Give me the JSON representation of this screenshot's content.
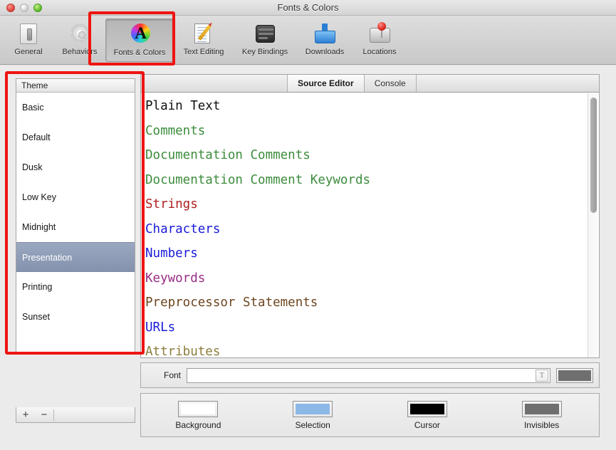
{
  "window": {
    "title": "Fonts & Colors",
    "traffic_lights": [
      "close-button",
      "minimize-button",
      "zoom-button"
    ]
  },
  "toolbar": {
    "items": [
      {
        "label": "General",
        "icon": "switch-plate-icon",
        "selected": false
      },
      {
        "label": "Behaviors",
        "icon": "gear-icon",
        "selected": false
      },
      {
        "label": "Fonts & Colors",
        "icon": "color-wheel-a-icon",
        "selected": true
      },
      {
        "label": "Text Editing",
        "icon": "paper-pencil-icon",
        "selected": false
      },
      {
        "label": "Key Bindings",
        "icon": "keyboard-icon",
        "selected": false
      },
      {
        "label": "Downloads",
        "icon": "download-tray-icon",
        "selected": false
      },
      {
        "label": "Locations",
        "icon": "hard-drive-pin-icon",
        "selected": false
      }
    ]
  },
  "sidebar": {
    "header": "Theme",
    "themes": [
      {
        "label": "Basic",
        "selected": false
      },
      {
        "label": "Default",
        "selected": false
      },
      {
        "label": "Dusk",
        "selected": false
      },
      {
        "label": "Low Key",
        "selected": false
      },
      {
        "label": "Midnight",
        "selected": false
      },
      {
        "label": "Presentation",
        "selected": true
      },
      {
        "label": "Printing",
        "selected": false
      },
      {
        "label": "Sunset",
        "selected": false
      }
    ],
    "footer": {
      "add_label": "+",
      "remove_label": "−"
    }
  },
  "main": {
    "tabs": [
      {
        "label": "Source Editor",
        "active": true
      },
      {
        "label": "Console",
        "active": false
      }
    ],
    "syntax_items": [
      {
        "label": "Plain Text",
        "color": "#111111"
      },
      {
        "label": "Comments",
        "color": "#3c8c3c"
      },
      {
        "label": "Documentation Comments",
        "color": "#3c8c3c"
      },
      {
        "label": "Documentation Comment Keywords",
        "color": "#3c8c3c"
      },
      {
        "label": "Strings",
        "color": "#ae2020"
      },
      {
        "label": "Characters",
        "color": "#1a1ad8"
      },
      {
        "label": "Numbers",
        "color": "#1a1ad8"
      },
      {
        "label": "Keywords",
        "color": "#9a2d85"
      },
      {
        "label": "Preprocessor Statements",
        "color": "#6d4620"
      },
      {
        "label": "URLs",
        "color": "#1a1ad8"
      },
      {
        "label": "Attributes",
        "color": "#8b7e3c"
      }
    ],
    "font_row": {
      "label": "Font",
      "value": "",
      "placeholder": "",
      "picker_glyph": "T",
      "swatch_color": "#6f6f6f"
    },
    "color_wells": [
      {
        "label": "Background",
        "color": "#ffffff"
      },
      {
        "label": "Selection",
        "color": "#8cb8e8"
      },
      {
        "label": "Cursor",
        "color": "#000000"
      },
      {
        "label": "Invisibles",
        "color": "#6f6f6f"
      }
    ]
  },
  "annotations": {
    "accent_color": "#ee1411",
    "boxes": [
      "toolbar-fonts-colors-highlight",
      "sidebar-theme-list-highlight"
    ]
  }
}
